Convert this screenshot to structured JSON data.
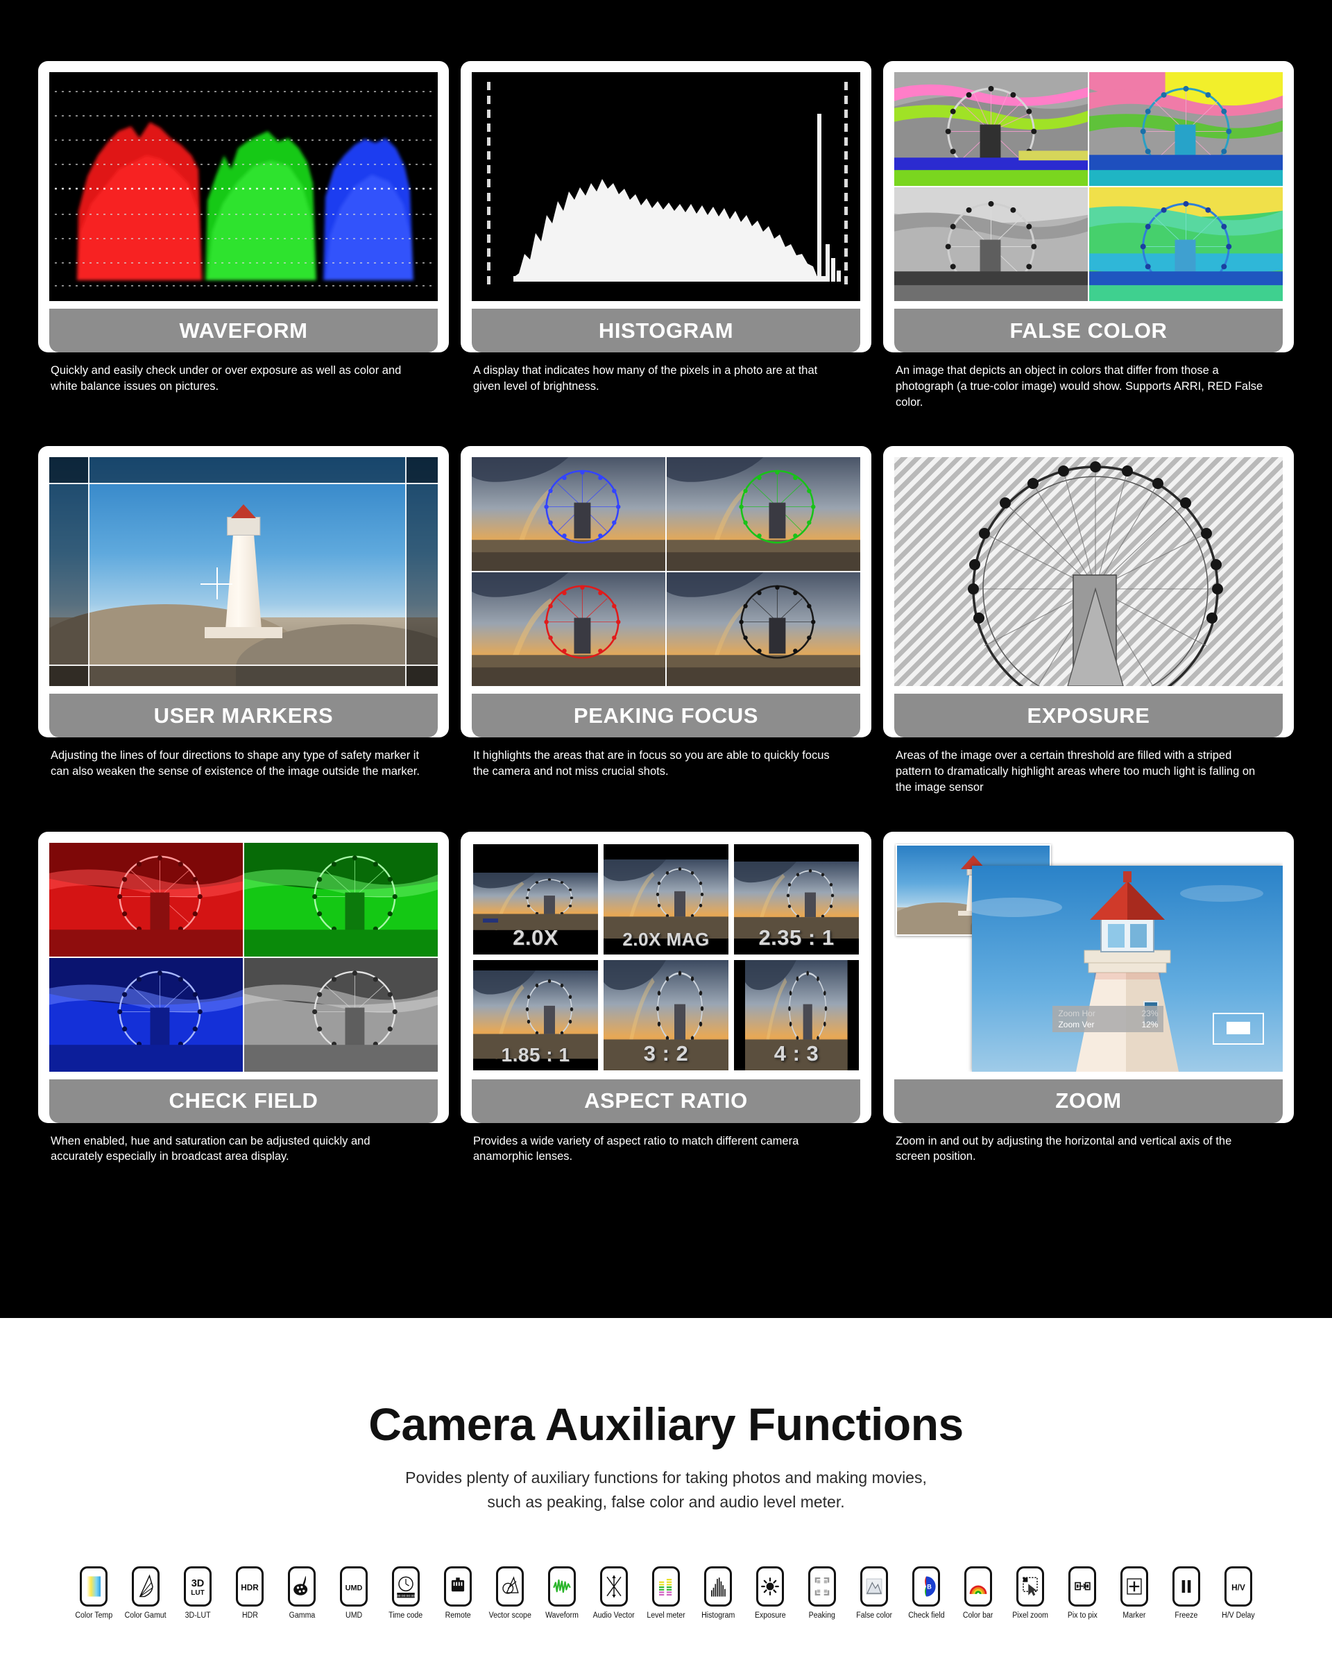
{
  "page": {
    "background": "#000000",
    "card_bg": "#ffffff",
    "title_bar_color": "#8d8d8d",
    "desc_color": "#ffffff"
  },
  "features": [
    {
      "id": "waveform",
      "title": "WAVEFORM",
      "description": "Quickly and easily check under or over exposure as well as color and white balance issues on pictures.",
      "media": "waveform-rgb-parade"
    },
    {
      "id": "histogram",
      "title": "HISTOGRAM",
      "description": "A display that indicates how many of the pixels in a photo are at that given level of brightness.",
      "media": "histogram-luma"
    },
    {
      "id": "false-color",
      "title": "FALSE COLOR",
      "description": "An image that depicts an object in colors that differ from those a photograph (a true-color image) would show. Supports ARRI, RED False color.",
      "media": "false-color-quad"
    },
    {
      "id": "user-markers",
      "title": "USER MARKERS",
      "description": "Adjusting the lines of four directions to shape any type of safety marker it can also weaken the sense of existence of the image outside the marker.",
      "media": "lighthouse-with-markers"
    },
    {
      "id": "peaking-focus",
      "title": "PEAKING FOCUS",
      "description": "It highlights the areas that are in focus so you are able to quickly focus the camera and not miss crucial shots.",
      "media": "peaking-quad"
    },
    {
      "id": "exposure",
      "title": "EXPOSURE",
      "description": "Areas of the image over a certain threshold are filled with a striped pattern to dramatically highlight areas where too much light is falling on the image sensor",
      "media": "zebra-stripes"
    },
    {
      "id": "check-field",
      "title": "CHECK FIELD",
      "description": "When enabled, hue and saturation can be adjusted quickly and accurately especially in broadcast area display.",
      "media": "check-field-quad"
    },
    {
      "id": "aspect-ratio",
      "title": "ASPECT RATIO",
      "description": "Provides a wide variety of aspect ratio to match different camera anamorphic lenses.",
      "media": "aspect-ratio-grid"
    },
    {
      "id": "zoom",
      "title": "ZOOM",
      "description": "Zoom in and out by adjusting the horizontal and vertical axis of the screen position.",
      "media": "zoom-preview"
    }
  ],
  "aspect_ratio_samples": [
    "2.0X",
    "2.0X MAG",
    "2.35 : 1",
    "1.85 : 1",
    "3 : 2",
    "4 : 3"
  ],
  "peaking_colors": [
    "#3344ff",
    "#19c219",
    "#e01b1b",
    "#222222"
  ],
  "check_field_colors": [
    "#e01010",
    "#18c218",
    "#1030e0",
    "#9a9a9a"
  ],
  "zoom_osd": {
    "hor_label": "Zoom Hor",
    "hor_value": "23%",
    "ver_label": "Zoom Ver",
    "ver_value": "12%"
  },
  "footer": {
    "title": "Camera Auxiliary Functions",
    "subtitle_line1": "Povides plenty of auxiliary functions for taking photos and making movies,",
    "subtitle_line2": "such as peaking, false color and audio level meter."
  },
  "icons": [
    {
      "name": "color-temp-icon",
      "label": "Color Temp",
      "glyph": "gradient"
    },
    {
      "name": "color-gamut-icon",
      "label": "Color Gamut",
      "glyph": "triangle-outline"
    },
    {
      "name": "3d-lut-icon",
      "label": "3D-LUT",
      "glyph": "3D",
      "sub": "LUT"
    },
    {
      "name": "hdr-icon",
      "label": "HDR",
      "glyph": "HDR"
    },
    {
      "name": "gamma-icon",
      "label": "Gamma",
      "glyph": "palette"
    },
    {
      "name": "umd-icon",
      "label": "UMD",
      "glyph": "UMD"
    },
    {
      "name": "time-code-icon",
      "label": "Time code",
      "glyph": "clock",
      "sub": "00:00:00:00"
    },
    {
      "name": "remote-icon",
      "label": "Remote",
      "glyph": "rj45"
    },
    {
      "name": "vector-scope-icon",
      "label": "Vector scope",
      "glyph": "vectorscope"
    },
    {
      "name": "waveform-icon",
      "label": "Waveform",
      "glyph": "waveform"
    },
    {
      "name": "audio-vector-icon",
      "label": "Audio Vector",
      "glyph": "audio-vector"
    },
    {
      "name": "level-meter-icon",
      "label": "Level meter",
      "glyph": "level-bars"
    },
    {
      "name": "histogram-icon",
      "label": "Histogram",
      "glyph": "hist-bars"
    },
    {
      "name": "exposure-icon",
      "label": "Exposure",
      "glyph": "sun"
    },
    {
      "name": "peaking-icon",
      "label": "Peaking",
      "glyph": "corners"
    },
    {
      "name": "false-color-icon",
      "label": "False color",
      "glyph": "mountains"
    },
    {
      "name": "check-field-icon",
      "label": "Check field",
      "glyph": "rgb-circle"
    },
    {
      "name": "color-bar-icon",
      "label": "Color bar",
      "glyph": "rainbow"
    },
    {
      "name": "pixel-zoom-icon",
      "label": "Pixel zoom",
      "glyph": "pointer-marquee"
    },
    {
      "name": "pix-to-pix-icon",
      "label": "Pix to pix",
      "glyph": "arrow-boxes"
    },
    {
      "name": "marker-icon",
      "label": "Marker",
      "glyph": "plus-box"
    },
    {
      "name": "freeze-icon",
      "label": "Freeze",
      "glyph": "pause"
    },
    {
      "name": "hv-delay-icon",
      "label": "H/V Delay",
      "glyph": "H/V"
    }
  ]
}
